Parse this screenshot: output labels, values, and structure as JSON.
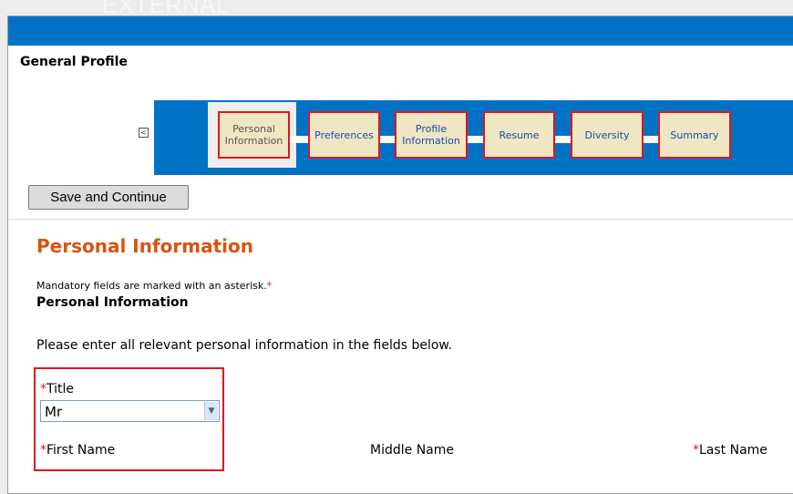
{
  "overlay_label": "EXTERNAL",
  "header": {
    "title": "General Profile"
  },
  "nav": {
    "prev_arrow": "<"
  },
  "steps": [
    {
      "label": "Personal\nInformation",
      "current": true
    },
    {
      "label": "Preferences",
      "current": false
    },
    {
      "label": "Profile\nInformation",
      "current": false
    },
    {
      "label": "Resume",
      "current": false
    },
    {
      "label": "Diversity",
      "current": false
    },
    {
      "label": "Summary",
      "current": false
    }
  ],
  "actions": {
    "save_continue": "Save and Continue"
  },
  "section": {
    "title": "Personal Information",
    "mandatory_note": "Mandatory fields are marked with an asterisk.",
    "asterisk": "*",
    "subtitle": "Personal Information",
    "instructions": "Please enter all relevant personal information in the fields below."
  },
  "fields": {
    "title_label": "Title",
    "title_value": "Mr",
    "first_name_label": "First Name",
    "middle_name_label": "Middle Name",
    "last_name_label": "Last Name"
  },
  "colors": {
    "brand_blue": "#0072c6",
    "highlight_red": "#e3141b",
    "section_orange": "#d9530f",
    "step_fill": "#efe6c3"
  }
}
